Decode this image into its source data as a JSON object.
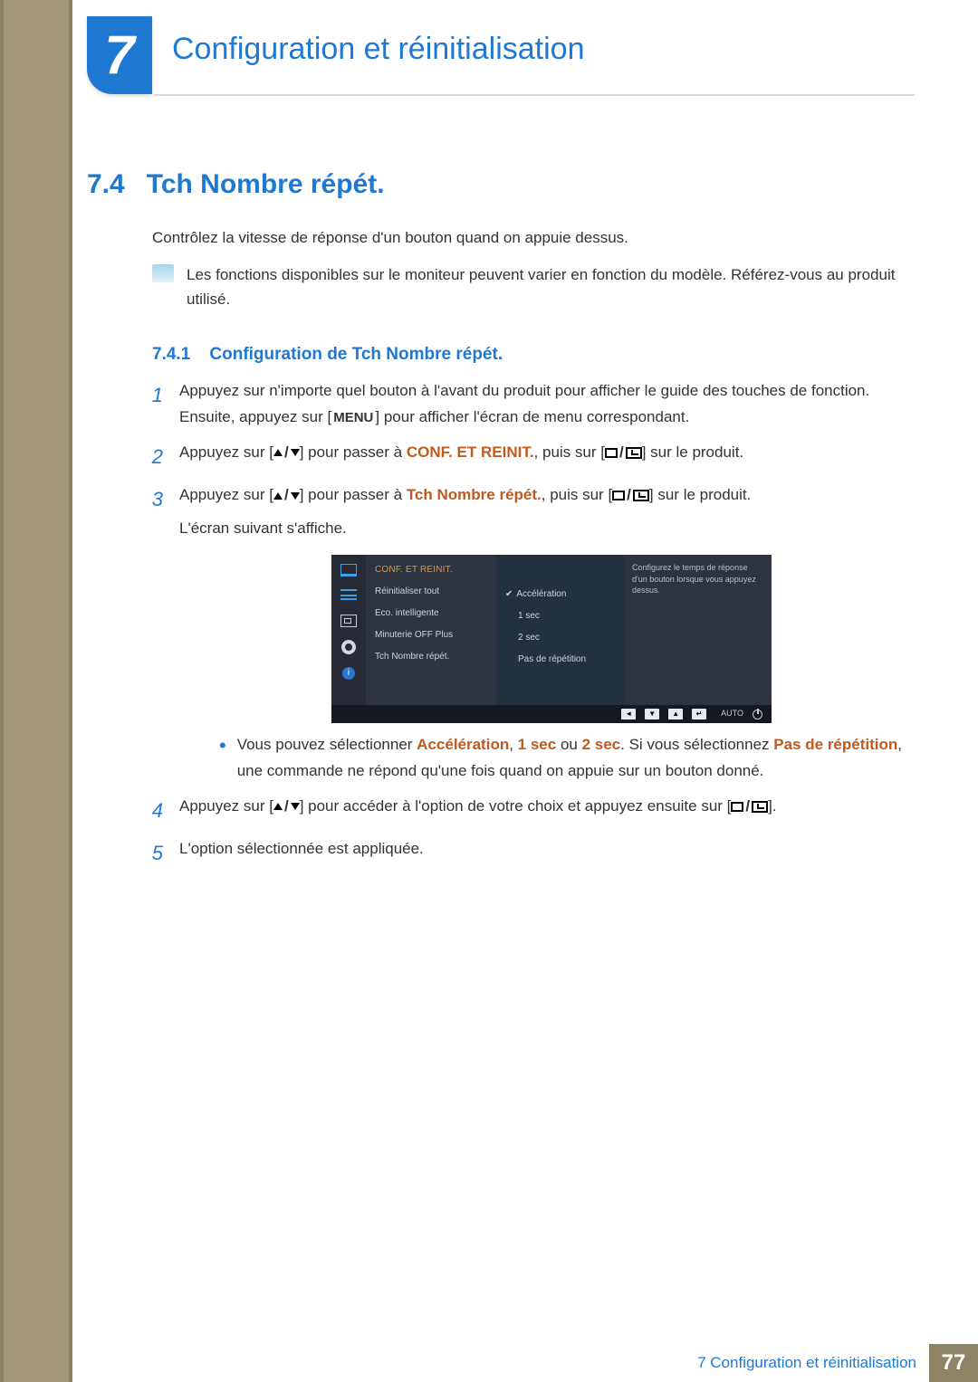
{
  "chapter": {
    "number": "7",
    "title": "Configuration et réinitialisation"
  },
  "section": {
    "number": "7.4",
    "title": "Tch Nombre répét."
  },
  "intro": "Contrôlez la vitesse de réponse d'un bouton quand on appuie dessus.",
  "note": "Les fonctions disponibles sur le moniteur peuvent varier en fonction du modèle. Référez-vous au produit utilisé.",
  "subsection": {
    "number": "7.4.1",
    "title": "Configuration de Tch Nombre répét."
  },
  "steps": {
    "s1a": "Appuyez sur n'importe quel bouton à l'avant du produit pour afficher le guide des touches de fonction. Ensuite, appuyez sur [",
    "s1_menu": "MENU",
    "s1b": "] pour afficher l'écran de menu correspondant.",
    "s2a": "Appuyez sur [",
    "s2b": "] pour passer à ",
    "s2_hl": "CONF. ET REINIT.",
    "s2c": ", puis sur [",
    "s2d": "] sur le produit.",
    "s3a": "Appuyez sur [",
    "s3b": "] pour passer à ",
    "s3_hl": "Tch Nombre répét.",
    "s3c": ", puis sur [",
    "s3d": "] sur le produit.",
    "s3e": "L'écran suivant s'affiche.",
    "bullet_a": "Vous pouvez sélectionner ",
    "bullet_hl1": "Accélération",
    "bullet_comma": ", ",
    "bullet_hl2": "1 sec",
    "bullet_or": " ou ",
    "bullet_hl3": "2 sec",
    "bullet_b": ". Si vous sélectionnez ",
    "bullet_hl4": "Pas de répétition",
    "bullet_c": ", une commande ne répond qu'une fois quand on appuie sur un bouton donné.",
    "s4a": "Appuyez sur [",
    "s4b": "] pour accéder à l'option de votre choix et appuyez ensuite sur [",
    "s4c": "].",
    "s5": "L'option sélectionnée est appliquée."
  },
  "osd": {
    "title": "CONF. ET REINIT.",
    "menu": [
      "Réinitialiser tout",
      "Eco. intelligente",
      "Minuterie OFF Plus",
      "Tch Nombre répét."
    ],
    "options": [
      "Accélération",
      "1 sec",
      "2 sec",
      "Pas de répétition"
    ],
    "tooltip": "Configurez le temps de réponse d'un bouton lorsque vous appuyez dessus.",
    "auto": "AUTO",
    "info_glyph": "i"
  },
  "footer": {
    "text": "7 Configuration et réinitialisation",
    "page": "77"
  }
}
